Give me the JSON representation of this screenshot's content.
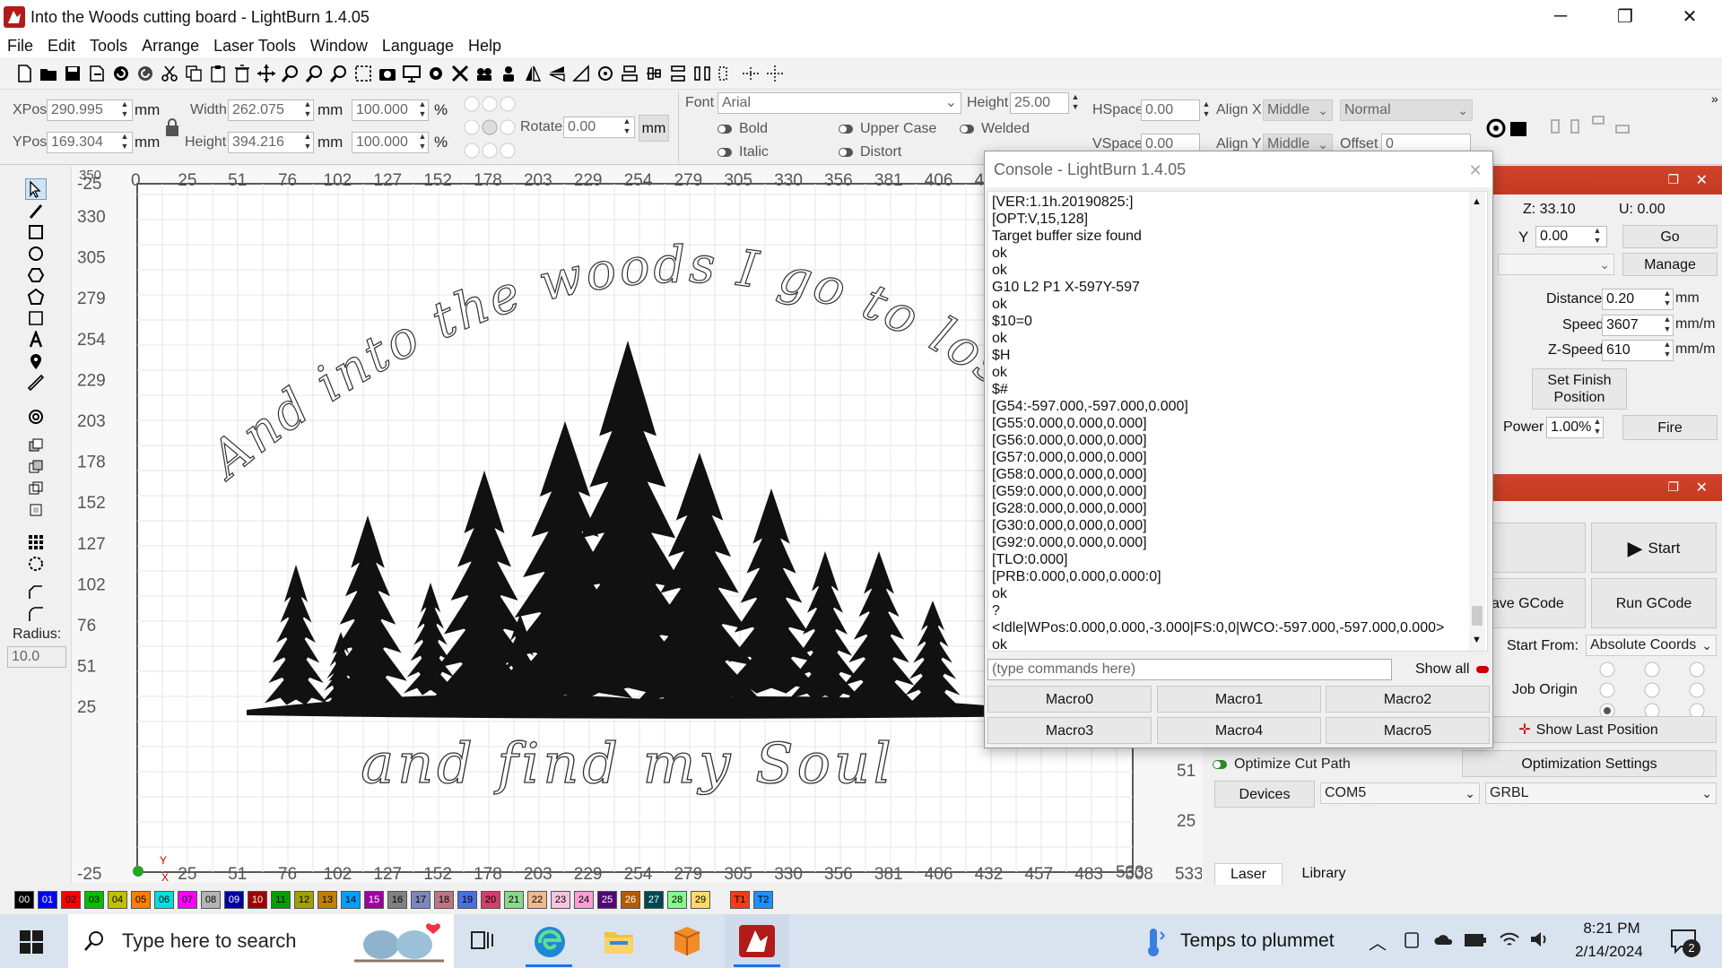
{
  "window": {
    "title": "Into the Woods cutting board - LightBurn 1.4.05",
    "minimize": "─",
    "restore": "❐",
    "close": "✕"
  },
  "menu": [
    "File",
    "Edit",
    "Tools",
    "Arrange",
    "Laser Tools",
    "Window",
    "Language",
    "Help"
  ],
  "props": {
    "xpos_label": "XPos",
    "xpos": "290.995",
    "ypos_label": "YPos",
    "ypos": "169.304",
    "mm": "mm",
    "width_label": "Width",
    "width": "262.075",
    "height_label": "Height",
    "height": "394.216",
    "scale_x": "100.000",
    "scale_y": "100.000",
    "pct": "%",
    "rotate_label": "Rotate",
    "rotate": "0.00",
    "mm_button": "mm",
    "font_label": "Font",
    "font": "Arial",
    "fheight_label": "Height",
    "fheight": "25.00",
    "hspace_label": "HSpace",
    "hspace": "0.00",
    "vspace_label": "VSpace",
    "vspace": "0.00",
    "alignx_label": "Align X",
    "alignx": "Middle",
    "aligny_label": "Align Y",
    "aligny": "Middle",
    "normal": "Normal",
    "offset_label": "Offset",
    "offset": "0",
    "bold": "Bold",
    "italic": "Italic",
    "upper": "Upper Case",
    "distort": "Distort",
    "welded": "Welded",
    "radius_label": "Radius:",
    "radius": "10.0"
  },
  "canvas": {
    "x_ticks": [
      "0",
      "25",
      "51",
      "76",
      "102",
      "127",
      "152",
      "178",
      "203",
      "229",
      "254",
      "279",
      "305",
      "330",
      "356",
      "381",
      "406",
      "432",
      "457",
      "483",
      "508",
      "533"
    ],
    "y_ticks": [
      "330",
      "305",
      "279",
      "254",
      "229",
      "203",
      "178",
      "152",
      "127",
      "102",
      "76",
      "51",
      "25",
      "-25"
    ],
    "top_left_tick": "-25",
    "corner_tick": "350",
    "bottom_left_tick": "-25",
    "text_arc": "And into the woods I go to lose my m",
    "text_bottom": "and find my Soul",
    "x_marker": "X",
    "y_marker": "Y"
  },
  "console": {
    "title": "Console - LightBurn 1.4.05",
    "close": "✕",
    "lines": [
      "[VER:1.1h.20190825:]",
      "[OPT:V,15,128]",
      "Target buffer size found",
      "ok",
      "ok",
      "G10 L2 P1 X-597Y-597",
      "ok",
      "$10=0",
      "ok",
      "$H",
      "ok",
      "$#",
      "[G54:-597.000,-597.000,0.000]",
      "[G55:0.000,0.000,0.000]",
      "[G56:0.000,0.000,0.000]",
      "[G57:0.000,0.000,0.000]",
      "[G58:0.000,0.000,0.000]",
      "[G59:0.000,0.000,0.000]",
      "[G28:0.000,0.000,0.000]",
      "[G30:0.000,0.000,0.000]",
      "[G92:0.000,0.000,0.000]",
      "[TLO:0.000]",
      "[PRB:0.000,0.000,0.000:0]",
      "ok",
      "?",
      "<Idle|WPos:0.000,0.000,-3.000|FS:0,0|WCO:-597.000,-597.000,0.000>",
      "ok"
    ],
    "cmd_placeholder": "(type commands here)",
    "show_all": "Show all",
    "macros": [
      "Macro0",
      "Macro1",
      "Macro2",
      "Macro3",
      "Macro4",
      "Macro5"
    ]
  },
  "move": {
    "z": "Z: 33.10",
    "u": "U: 0.00",
    "y_label": "Y",
    "y": "0.00",
    "go": "Go",
    "manage": "Manage",
    "distance_label": "Distance",
    "distance": "0.20",
    "mm": "mm",
    "speed_label": "Speed",
    "speed": "3607",
    "mmm": "mm/m",
    "zspeed_label": "Z-Speed",
    "zspeed": "610",
    "set_finish": "Set Finish Position",
    "power_label": "Power",
    "power": "1.00%",
    "fire": "Fire"
  },
  "laser": {
    "start": "Start",
    "save_gcode": "Save GCode",
    "run_gcode": "Run GCode",
    "start_from_label": "Start From:",
    "start_from": "Absolute Coords",
    "job_origin": "Job Origin",
    "show_last": "Show Last Position",
    "optimize": "Optimize Cut Path",
    "opt_settings": "Optimization Settings",
    "devices": "Devices",
    "port": "COM5",
    "firmware": "GRBL",
    "tab_laser": "Laser",
    "tab_library": "Library",
    "ruler_51": "51",
    "ruler_25": "25",
    "ruler_533": "533"
  },
  "palette": [
    {
      "l": "00",
      "c": "#000000"
    },
    {
      "l": "01",
      "c": "#0000ff"
    },
    {
      "l": "02",
      "c": "#ff0000"
    },
    {
      "l": "03",
      "c": "#00c000"
    },
    {
      "l": "04",
      "c": "#c0c000"
    },
    {
      "l": "05",
      "c": "#ff8000"
    },
    {
      "l": "06",
      "c": "#00e0e0"
    },
    {
      "l": "07",
      "c": "#ff00ff"
    },
    {
      "l": "08",
      "c": "#b4b4b4"
    },
    {
      "l": "09",
      "c": "#0000a0"
    },
    {
      "l": "10",
      "c": "#a00000"
    },
    {
      "l": "11",
      "c": "#00a000"
    },
    {
      "l": "12",
      "c": "#a0a000"
    },
    {
      "l": "13",
      "c": "#c08000"
    },
    {
      "l": "14",
      "c": "#00a0ff"
    },
    {
      "l": "15",
      "c": "#a000a0"
    },
    {
      "l": "16",
      "c": "#808080"
    },
    {
      "l": "17",
      "c": "#7d87b9"
    },
    {
      "l": "18",
      "c": "#bb7784"
    },
    {
      "l": "19",
      "c": "#4a6fe3"
    },
    {
      "l": "20",
      "c": "#d33f6a"
    },
    {
      "l": "21",
      "c": "#8cd78c"
    },
    {
      "l": "22",
      "c": "#f0b98d"
    },
    {
      "l": "23",
      "c": "#f6c4e1"
    },
    {
      "l": "24",
      "c": "#fa9ed4"
    },
    {
      "l": "25",
      "c": "#500a78"
    },
    {
      "l": "26",
      "c": "#b45a00"
    },
    {
      "l": "27",
      "c": "#004754"
    },
    {
      "l": "28",
      "c": "#86fa88"
    },
    {
      "l": "29",
      "c": "#ffdb66"
    },
    {
      "l": "T1",
      "c": "#f33b16"
    },
    {
      "l": "T2",
      "c": "#1e90ff"
    }
  ],
  "taskbar": {
    "search": "Type here to search",
    "weather": "Temps to plummet",
    "time": "8:21 PM",
    "date": "2/14/2024",
    "notif": "2"
  }
}
